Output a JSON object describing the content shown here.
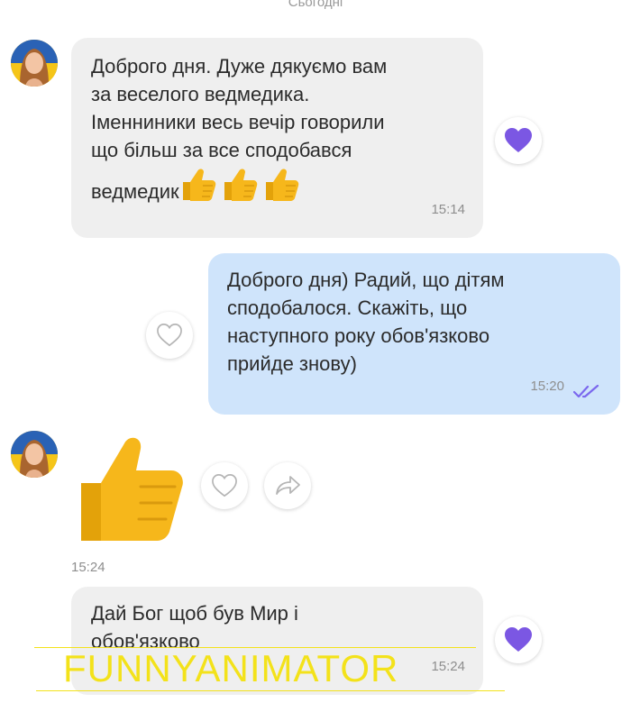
{
  "chat": {
    "date_separator": "Сьогодні",
    "messages": [
      {
        "direction": "incoming",
        "text": "Доброго дня.  Дуже дякуємо вам\nза веселого ведмедика.\nІменниники весь вечір говорили\nщо більш за все сподобався\nведмедик",
        "emoji": "thumbs-up ×3",
        "time": "15:14",
        "reaction": "liked"
      },
      {
        "direction": "outgoing",
        "text": "Доброго дня) Радий, що дітям\nсподобалося. Скажіть, що\nнаступного року обов'язково\nприйде знову)",
        "time": "15:20",
        "status": "read"
      },
      {
        "direction": "incoming",
        "sticker": "thumbs-up",
        "time": "15:24"
      },
      {
        "direction": "incoming",
        "text": "Дай Бог щоб був Мир і\nобов'язково",
        "time": "15:24",
        "reaction": "liked"
      }
    ]
  },
  "watermark": "FUNNYANIMATOR",
  "colors": {
    "incoming_bubble": "#efefef",
    "outgoing_bubble": "#cfe4fb",
    "heart_accent": "#7b57e3",
    "read_ticks": "#7b68ee",
    "watermark": "#f3e21a"
  }
}
